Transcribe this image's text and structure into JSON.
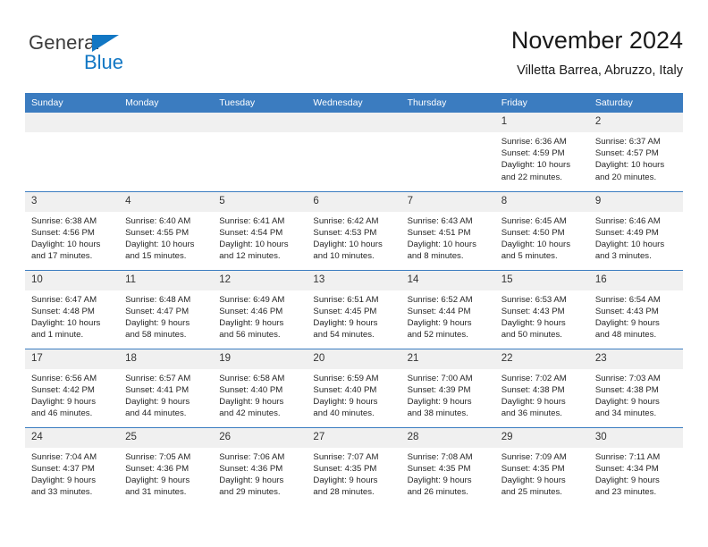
{
  "brand": {
    "name_top": "General",
    "name_bottom": "Blue",
    "accent_color": "#1277c4",
    "triangle_icon": "triangle-icon"
  },
  "header": {
    "title": "November 2024",
    "subtitle": "Villetta Barrea, Abruzzo, Italy"
  },
  "calendar": {
    "header_bg": "#3b7cc0",
    "daynum_bg": "#f0f0f0",
    "weekdays": [
      "Sunday",
      "Monday",
      "Tuesday",
      "Wednesday",
      "Thursday",
      "Friday",
      "Saturday"
    ],
    "weeks": [
      [
        {
          "day": "",
          "lines": []
        },
        {
          "day": "",
          "lines": []
        },
        {
          "day": "",
          "lines": []
        },
        {
          "day": "",
          "lines": []
        },
        {
          "day": "",
          "lines": []
        },
        {
          "day": "1",
          "lines": [
            "Sunrise: 6:36 AM",
            "Sunset: 4:59 PM",
            "Daylight: 10 hours",
            "and 22 minutes."
          ]
        },
        {
          "day": "2",
          "lines": [
            "Sunrise: 6:37 AM",
            "Sunset: 4:57 PM",
            "Daylight: 10 hours",
            "and 20 minutes."
          ]
        }
      ],
      [
        {
          "day": "3",
          "lines": [
            "Sunrise: 6:38 AM",
            "Sunset: 4:56 PM",
            "Daylight: 10 hours",
            "and 17 minutes."
          ]
        },
        {
          "day": "4",
          "lines": [
            "Sunrise: 6:40 AM",
            "Sunset: 4:55 PM",
            "Daylight: 10 hours",
            "and 15 minutes."
          ]
        },
        {
          "day": "5",
          "lines": [
            "Sunrise: 6:41 AM",
            "Sunset: 4:54 PM",
            "Daylight: 10 hours",
            "and 12 minutes."
          ]
        },
        {
          "day": "6",
          "lines": [
            "Sunrise: 6:42 AM",
            "Sunset: 4:53 PM",
            "Daylight: 10 hours",
            "and 10 minutes."
          ]
        },
        {
          "day": "7",
          "lines": [
            "Sunrise: 6:43 AM",
            "Sunset: 4:51 PM",
            "Daylight: 10 hours",
            "and 8 minutes."
          ]
        },
        {
          "day": "8",
          "lines": [
            "Sunrise: 6:45 AM",
            "Sunset: 4:50 PM",
            "Daylight: 10 hours",
            "and 5 minutes."
          ]
        },
        {
          "day": "9",
          "lines": [
            "Sunrise: 6:46 AM",
            "Sunset: 4:49 PM",
            "Daylight: 10 hours",
            "and 3 minutes."
          ]
        }
      ],
      [
        {
          "day": "10",
          "lines": [
            "Sunrise: 6:47 AM",
            "Sunset: 4:48 PM",
            "Daylight: 10 hours",
            "and 1 minute."
          ]
        },
        {
          "day": "11",
          "lines": [
            "Sunrise: 6:48 AM",
            "Sunset: 4:47 PM",
            "Daylight: 9 hours",
            "and 58 minutes."
          ]
        },
        {
          "day": "12",
          "lines": [
            "Sunrise: 6:49 AM",
            "Sunset: 4:46 PM",
            "Daylight: 9 hours",
            "and 56 minutes."
          ]
        },
        {
          "day": "13",
          "lines": [
            "Sunrise: 6:51 AM",
            "Sunset: 4:45 PM",
            "Daylight: 9 hours",
            "and 54 minutes."
          ]
        },
        {
          "day": "14",
          "lines": [
            "Sunrise: 6:52 AM",
            "Sunset: 4:44 PM",
            "Daylight: 9 hours",
            "and 52 minutes."
          ]
        },
        {
          "day": "15",
          "lines": [
            "Sunrise: 6:53 AM",
            "Sunset: 4:43 PM",
            "Daylight: 9 hours",
            "and 50 minutes."
          ]
        },
        {
          "day": "16",
          "lines": [
            "Sunrise: 6:54 AM",
            "Sunset: 4:43 PM",
            "Daylight: 9 hours",
            "and 48 minutes."
          ]
        }
      ],
      [
        {
          "day": "17",
          "lines": [
            "Sunrise: 6:56 AM",
            "Sunset: 4:42 PM",
            "Daylight: 9 hours",
            "and 46 minutes."
          ]
        },
        {
          "day": "18",
          "lines": [
            "Sunrise: 6:57 AM",
            "Sunset: 4:41 PM",
            "Daylight: 9 hours",
            "and 44 minutes."
          ]
        },
        {
          "day": "19",
          "lines": [
            "Sunrise: 6:58 AM",
            "Sunset: 4:40 PM",
            "Daylight: 9 hours",
            "and 42 minutes."
          ]
        },
        {
          "day": "20",
          "lines": [
            "Sunrise: 6:59 AM",
            "Sunset: 4:40 PM",
            "Daylight: 9 hours",
            "and 40 minutes."
          ]
        },
        {
          "day": "21",
          "lines": [
            "Sunrise: 7:00 AM",
            "Sunset: 4:39 PM",
            "Daylight: 9 hours",
            "and 38 minutes."
          ]
        },
        {
          "day": "22",
          "lines": [
            "Sunrise: 7:02 AM",
            "Sunset: 4:38 PM",
            "Daylight: 9 hours",
            "and 36 minutes."
          ]
        },
        {
          "day": "23",
          "lines": [
            "Sunrise: 7:03 AM",
            "Sunset: 4:38 PM",
            "Daylight: 9 hours",
            "and 34 minutes."
          ]
        }
      ],
      [
        {
          "day": "24",
          "lines": [
            "Sunrise: 7:04 AM",
            "Sunset: 4:37 PM",
            "Daylight: 9 hours",
            "and 33 minutes."
          ]
        },
        {
          "day": "25",
          "lines": [
            "Sunrise: 7:05 AM",
            "Sunset: 4:36 PM",
            "Daylight: 9 hours",
            "and 31 minutes."
          ]
        },
        {
          "day": "26",
          "lines": [
            "Sunrise: 7:06 AM",
            "Sunset: 4:36 PM",
            "Daylight: 9 hours",
            "and 29 minutes."
          ]
        },
        {
          "day": "27",
          "lines": [
            "Sunrise: 7:07 AM",
            "Sunset: 4:35 PM",
            "Daylight: 9 hours",
            "and 28 minutes."
          ]
        },
        {
          "day": "28",
          "lines": [
            "Sunrise: 7:08 AM",
            "Sunset: 4:35 PM",
            "Daylight: 9 hours",
            "and 26 minutes."
          ]
        },
        {
          "day": "29",
          "lines": [
            "Sunrise: 7:09 AM",
            "Sunset: 4:35 PM",
            "Daylight: 9 hours",
            "and 25 minutes."
          ]
        },
        {
          "day": "30",
          "lines": [
            "Sunrise: 7:11 AM",
            "Sunset: 4:34 PM",
            "Daylight: 9 hours",
            "and 23 minutes."
          ]
        }
      ]
    ]
  }
}
